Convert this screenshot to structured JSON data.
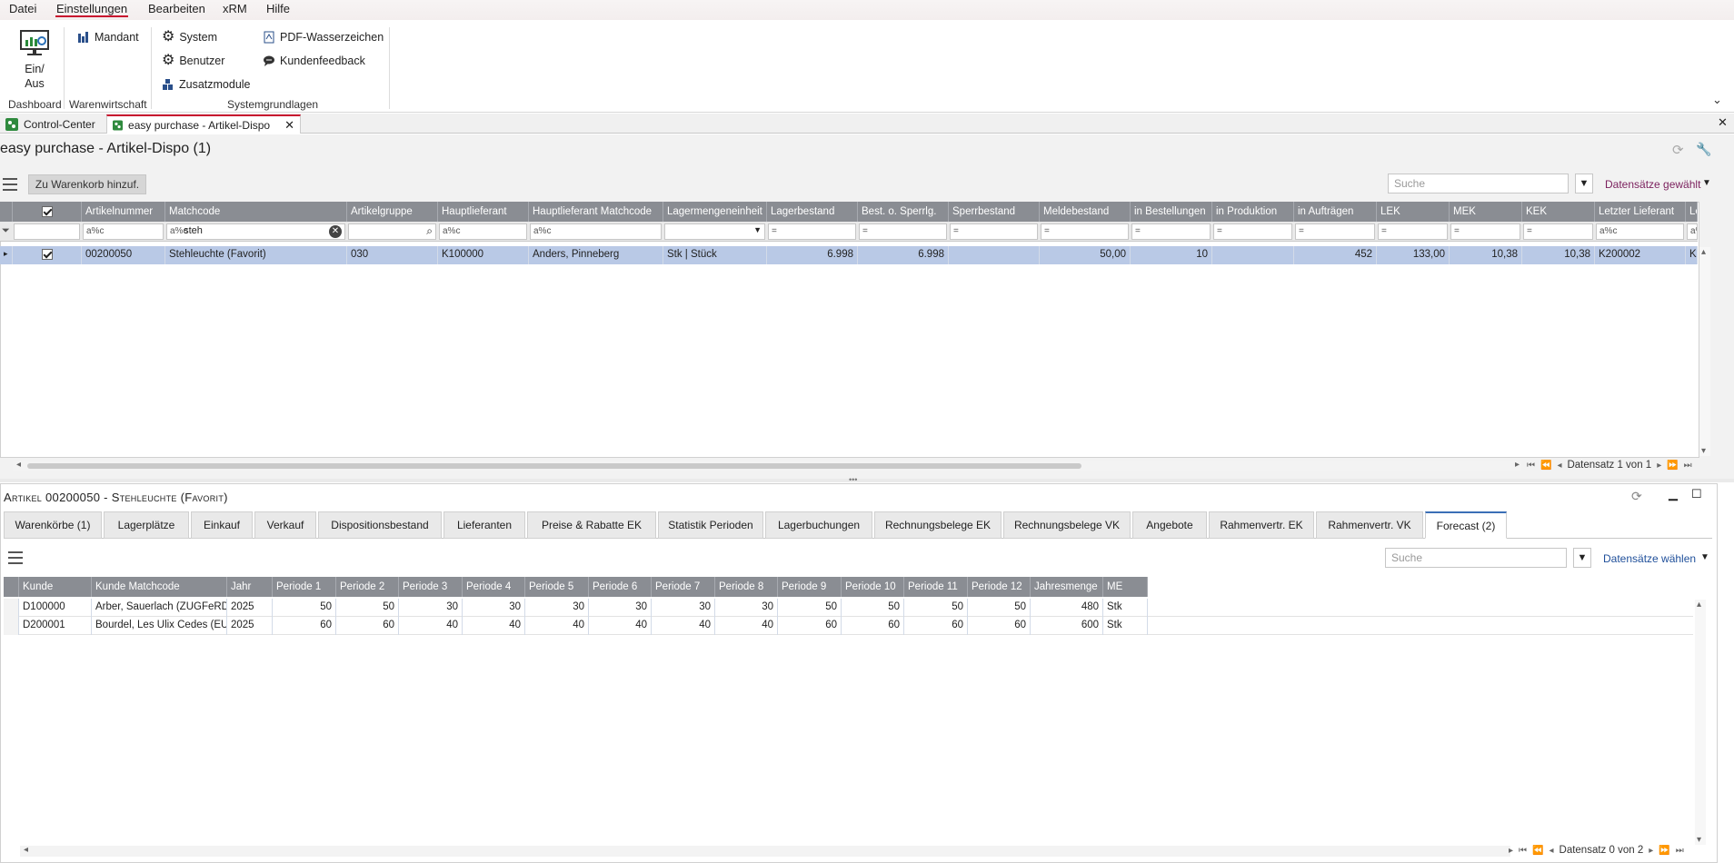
{
  "menu": [
    "Datei",
    "Einstellungen",
    "Bearbeiten",
    "xRM",
    "Hilfe"
  ],
  "menu_active": "Einstellungen",
  "ribbon": {
    "dashboard_btn_line1": "Ein/",
    "dashboard_btn_line2": "Aus",
    "mandant": "Mandant",
    "system": "System",
    "benutzer": "Benutzer",
    "zusatzmodule": "Zusatzmodule",
    "pdf_wasserzeichen": "PDF-Wasserzeichen",
    "kundenfeedback": "Kundenfeedback",
    "group_dashboard": "Dashboard",
    "group_warenwirtschaft": "Warenwirtschaft",
    "group_systemgrundlagen": "Systemgrundlagen"
  },
  "doctabs": {
    "control_center": "Control-Center",
    "active": "easy purchase - Artikel-Dispo"
  },
  "module_title": "easy purchase  - Artikel-Dispo (1)",
  "toolbar": {
    "add_to_basket": "Zu Warenkorb hinzuf.",
    "search_placeholder": "Suche",
    "records_selected": "Datensätze gewählt"
  },
  "grid": {
    "columns": [
      "Artikelnummer",
      "Matchcode",
      "Artikelgruppe",
      "Hauptlieferant",
      "Hauptlieferant Matchcode",
      "Lagermengeneinheit",
      "Lagerbestand",
      "Best. o. Sperrlg.",
      "Sperrbestand",
      "Meldebestand",
      "in Bestellungen",
      "in Produktion",
      "in Aufträgen",
      "LEK",
      "MEK",
      "KEK",
      "Letzter Lieferant",
      "Le"
    ],
    "filter_matchcode": "steh",
    "row": {
      "artikelnummer": "00200050",
      "matchcode": "Stehleuchte  (Favorit)",
      "artikelgruppe": "030",
      "hauptlieferant": "K100000",
      "hauptlieferant_matchcode": "Anders, Pinneberg",
      "lagermengeneinheit": "Stk  |  Stück",
      "lagerbestand": "6.998",
      "best_o_sperrlg": "6.998",
      "sperrbestand": "",
      "meldebestand": "50,00",
      "in_bestellungen": "10",
      "in_produktion": "",
      "in_auftraegen": "452",
      "lek": "133,00",
      "mek": "10,38",
      "kek": "10,38",
      "letzter_lieferant": "K200002",
      "le": "K"
    },
    "pager": "Datensatz 1 von 1"
  },
  "detail": {
    "title": "Artikel 00200050 - Stehleuchte  (Favorit)",
    "tabs": [
      "Warenkörbe (1)",
      "Lagerplätze",
      "Einkauf",
      "Verkauf",
      "Dispositionsbestand",
      "Lieferanten",
      "Preise & Rabatte EK",
      "Statistik Perioden",
      "Lagerbuchungen",
      "Rechnungsbelege EK",
      "Rechnungsbelege VK",
      "Angebote",
      "Rahmenvertr. EK",
      "Rahmenvertr. VK",
      "Forecast (2)"
    ],
    "active_tab": "Forecast (2)",
    "search_placeholder": "Suche",
    "records_select": "Datensätze wählen",
    "columns": [
      "Kunde",
      "Kunde Matchcode",
      "Jahr",
      "Periode 1",
      "Periode 2",
      "Periode 3",
      "Periode 4",
      "Periode 5",
      "Periode 6",
      "Periode 7",
      "Periode 8",
      "Periode 9",
      "Periode 10",
      "Periode 11",
      "Periode 12",
      "Jahresmenge",
      "ME"
    ],
    "rows": [
      [
        "D100000",
        "Arber, Sauerlach (ZUGFeRD)",
        "2025",
        "50",
        "50",
        "30",
        "30",
        "30",
        "30",
        "30",
        "30",
        "50",
        "50",
        "50",
        "50",
        "480",
        "Stk"
      ],
      [
        "D200001",
        "Bourdel, Les Ulix Cedes (EU...",
        "2025",
        "60",
        "60",
        "40",
        "40",
        "40",
        "40",
        "40",
        "40",
        "60",
        "60",
        "60",
        "60",
        "600",
        "Stk"
      ]
    ],
    "pager": "Datensatz 0 von 2"
  },
  "colors": {
    "accent_red": "#c8102e",
    "header_grey": "#8a8d93",
    "selection_blue": "#b9c9e6",
    "link_purple": "#7a1f5c",
    "tab_active_blue": "#3b6fb6"
  }
}
